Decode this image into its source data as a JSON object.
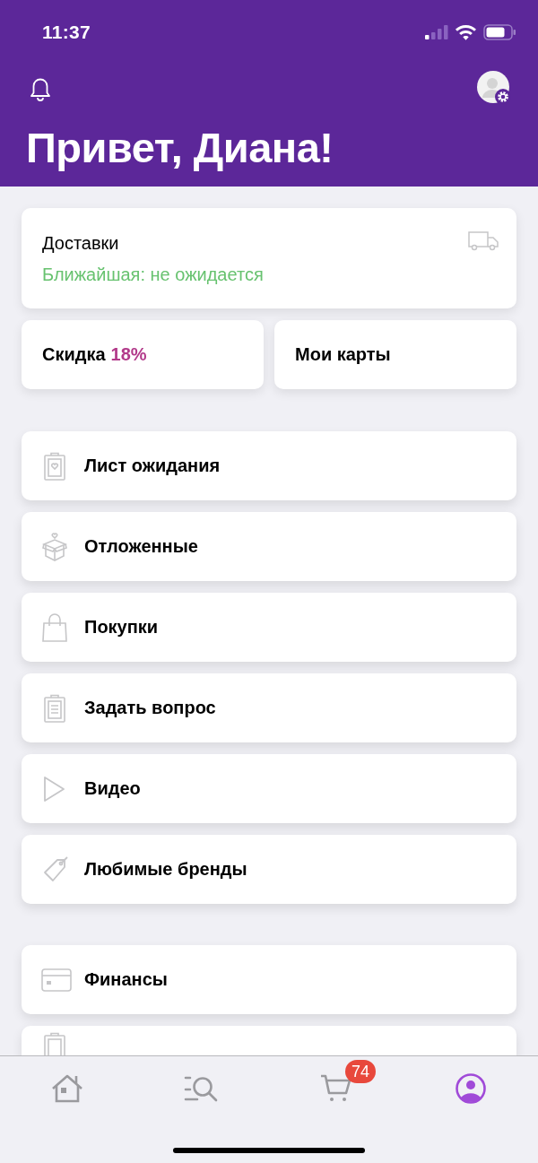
{
  "status_bar": {
    "time": "11:37"
  },
  "header": {
    "greeting": "Привет, Диана!"
  },
  "delivery": {
    "title": "Доставки",
    "status": "Ближайшая: не ожидается"
  },
  "discount": {
    "label": "Скидка",
    "value": "18%"
  },
  "cards": {
    "label": "Мои карты"
  },
  "menu_groups": [
    {
      "items": [
        {
          "kind": "row",
          "label": "Лист ожидания"
        },
        {
          "kind": "row",
          "label": "Отложенные"
        },
        {
          "kind": "row",
          "label": "Покупки"
        },
        {
          "kind": "row",
          "label": "Задать вопрос"
        },
        {
          "kind": "row",
          "label": "Видео"
        },
        {
          "kind": "row",
          "label": "Любимые бренды"
        }
      ]
    },
    {
      "items": [
        {
          "kind": "row",
          "label": "Финансы"
        },
        {
          "kind": "clipped"
        }
      ]
    }
  ],
  "tab_bar": [
    {
      "selected": false
    },
    {
      "selected": false
    },
    {
      "selected": false,
      "badge": "74"
    },
    {
      "selected": true
    }
  ]
}
